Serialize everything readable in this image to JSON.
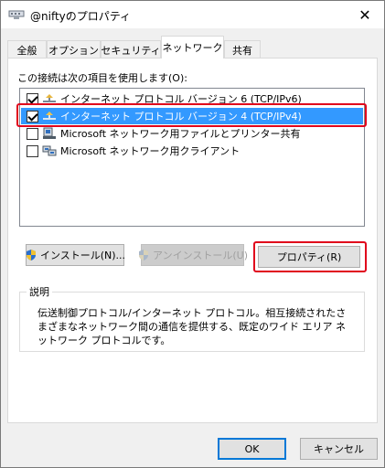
{
  "window": {
    "title": "@niftyのプロパティ",
    "close_symbol": "✕"
  },
  "tabs": [
    {
      "label": "全般"
    },
    {
      "label": "オプション"
    },
    {
      "label": "セキュリティ"
    },
    {
      "label": "ネットワーク",
      "active": true
    },
    {
      "label": "共有"
    }
  ],
  "connection_items_label": "この接続は次の項目を使用します(O):",
  "items": [
    {
      "label": "インターネット プロトコル バージョン 6 (TCP/IPv6)",
      "checked": true,
      "icon": "network-protocol-icon"
    },
    {
      "label": "インターネット プロトコル バージョン 4 (TCP/IPv4)",
      "checked": true,
      "selected": true,
      "icon": "network-protocol-icon"
    },
    {
      "label": "Microsoft ネットワーク用ファイルとプリンター共有",
      "checked": false,
      "icon": "file-printer-share-icon"
    },
    {
      "label": "Microsoft ネットワーク用クライアント",
      "checked": false,
      "icon": "network-client-icon"
    }
  ],
  "buttons": {
    "install": "インストール(N)...",
    "uninstall": "アンインストール(U)",
    "properties": "プロパティ(R)",
    "ok": "OK",
    "cancel": "キャンセル"
  },
  "description": {
    "title": "説明",
    "text": "伝送制御プロトコル/インターネット プロトコル。相互接続されたさまざまなネットワーク間の通信を提供する、既定のワイド エリア ネットワーク プロトコルです。"
  },
  "colors": {
    "selection": "#3399ff",
    "highlight_outline": "#e0001b",
    "default_button_border": "#0078d7"
  }
}
